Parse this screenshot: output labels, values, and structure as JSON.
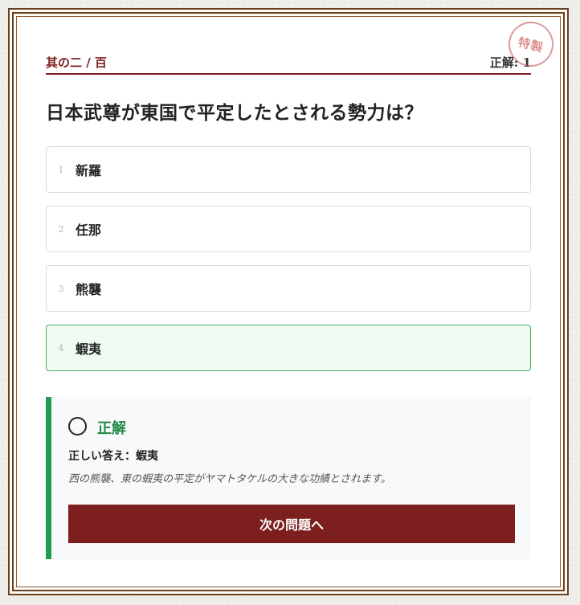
{
  "header": {
    "progress": "其の二 / 百",
    "score_label": "正解: ",
    "score_value": "1",
    "stamp": "特製"
  },
  "question": "日本武尊が東国で平定したとされる勢力は？",
  "options": [
    {
      "number": "1",
      "label": "新羅"
    },
    {
      "number": "2",
      "label": "任那"
    },
    {
      "number": "3",
      "label": "熊襲"
    },
    {
      "number": "4",
      "label": "蝦夷"
    }
  ],
  "result": {
    "status": "正解",
    "answer_prefix": "正しい答え：",
    "answer": "蝦夷",
    "explanation": "西の熊襲、東の蝦夷の平定がヤマトタケルの大きな功績とされます。",
    "next_button": "次の問題へ"
  },
  "colors": {
    "accent": "#7d1f1f",
    "correct": "#1f9e4f",
    "correct_bg": "#effbf1",
    "frame": "#6b3f1d"
  }
}
